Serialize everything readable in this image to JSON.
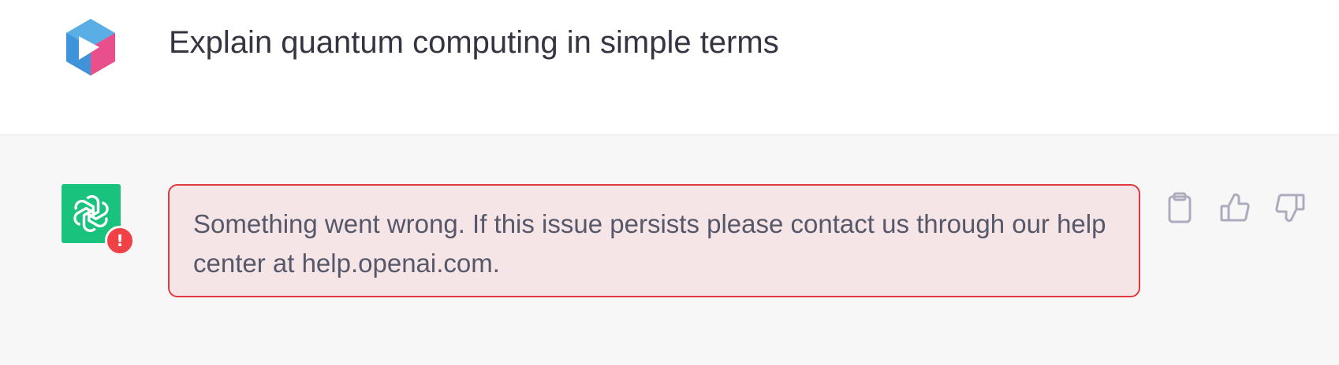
{
  "user": {
    "message": "Explain quantum computing in simple terms",
    "avatar_icon": "user-cube-avatar-icon"
  },
  "assistant": {
    "avatar_icon": "openai-logo-icon",
    "avatar_color": "#19c37d",
    "error_badge": "!",
    "error_badge_color": "#ef4146",
    "error_message": "Something went wrong. If this issue persists please contact us through our help center at help.openai.com.",
    "error_border_color": "#e0393f",
    "error_background": "#f5e5e7"
  },
  "actions": [
    {
      "icon": "clipboard-icon"
    },
    {
      "icon": "thumbs-up-icon"
    },
    {
      "icon": "thumbs-down-icon"
    }
  ]
}
